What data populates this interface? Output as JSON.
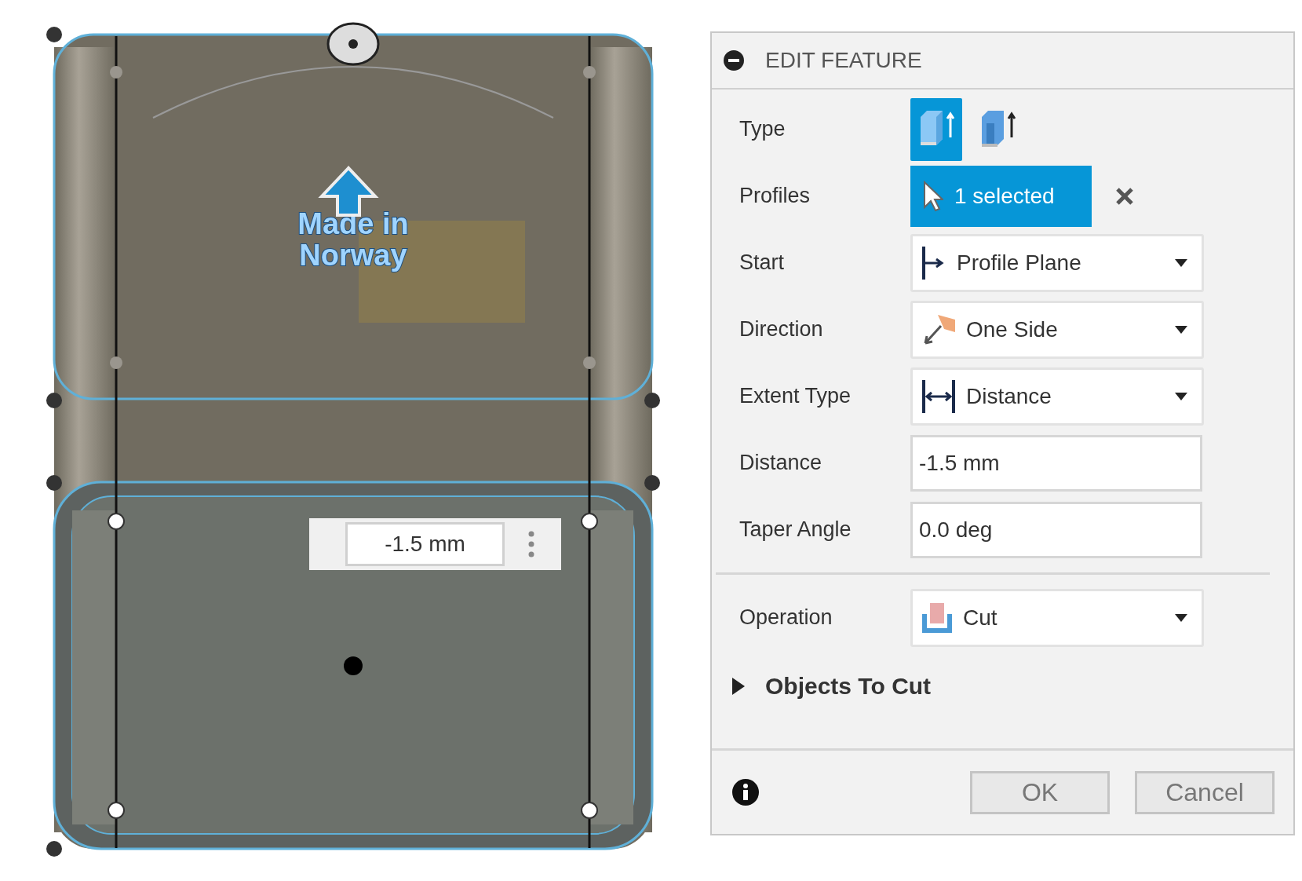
{
  "viewport": {
    "model_text": [
      "Made in",
      "Norway"
    ],
    "dimension_input": {
      "value": "-1.5 mm"
    }
  },
  "panel": {
    "title": "EDIT FEATURE",
    "expanded": true,
    "rows": [
      {
        "kind": "type",
        "label": "Type",
        "options": [
          {
            "selected": true
          },
          {
            "selected": false
          }
        ]
      },
      {
        "kind": "selection",
        "label": "Profiles",
        "value": "1 selected"
      },
      {
        "kind": "dropdown",
        "label": "Start",
        "value": "Profile Plane"
      },
      {
        "kind": "dropdown",
        "label": "Direction",
        "value": "One Side"
      },
      {
        "kind": "dropdown",
        "label": "Extent Type",
        "value": "Distance"
      },
      {
        "kind": "input",
        "label": "Distance",
        "value": "-1.5 mm"
      },
      {
        "kind": "input",
        "label": "Taper Angle",
        "value": "0.0 deg"
      },
      {
        "kind": "divider"
      },
      {
        "kind": "dropdown",
        "label": "Operation",
        "value": "Cut"
      }
    ],
    "group": {
      "label": "Objects To Cut",
      "expanded": false
    },
    "buttons": [
      "OK",
      "Cancel"
    ]
  }
}
